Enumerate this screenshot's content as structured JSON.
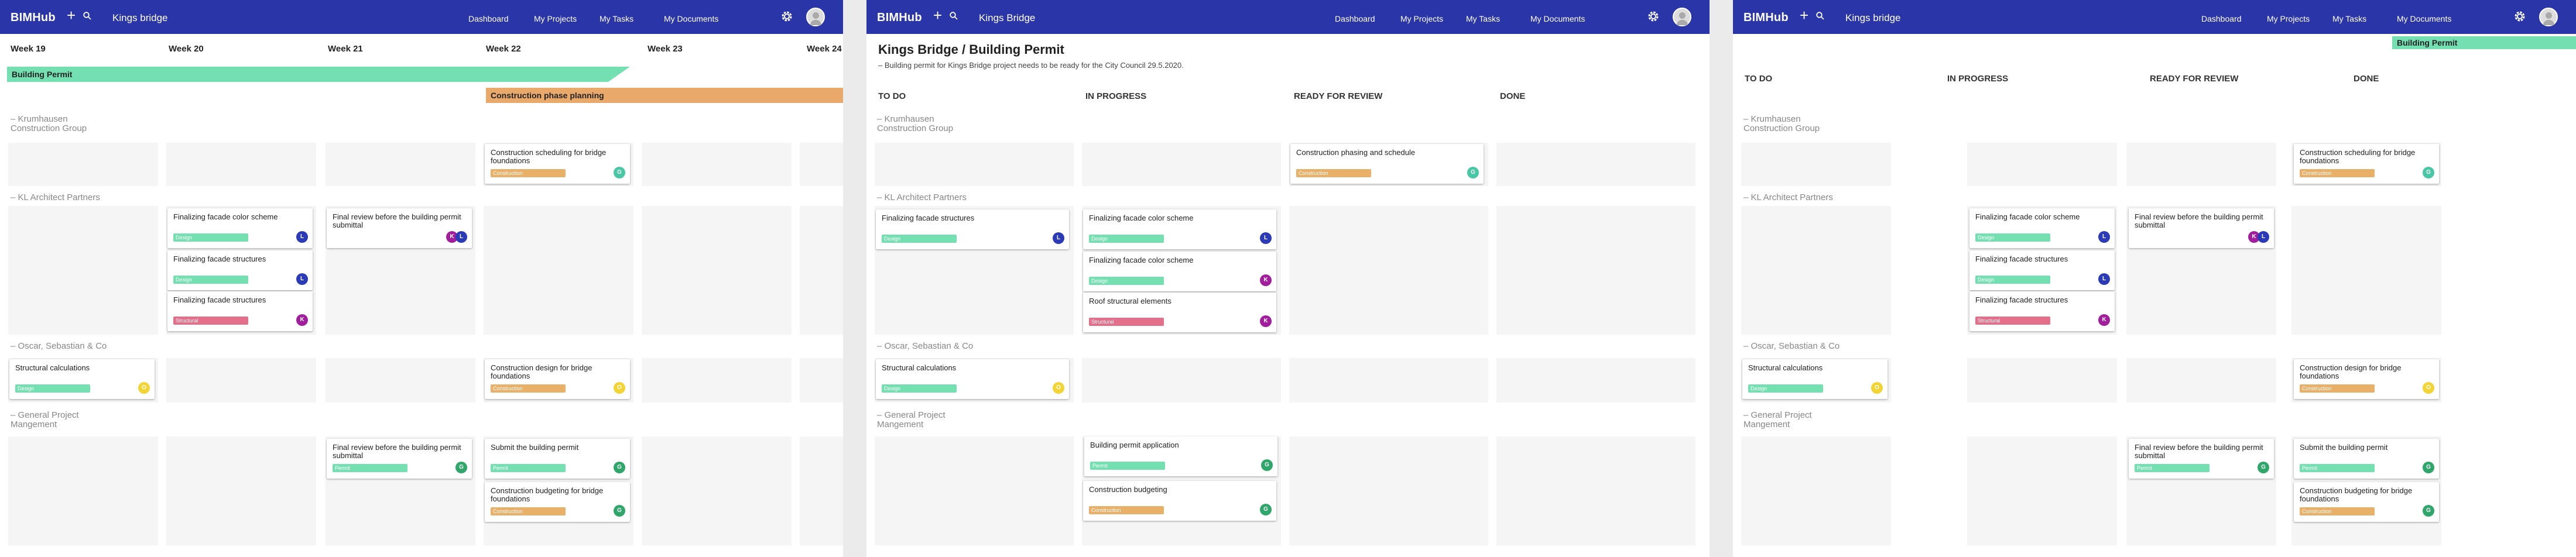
{
  "app": {
    "logo": "BIMHub",
    "nav": [
      "Dashboard",
      "My Projects",
      "My Tasks",
      "My Documents"
    ]
  },
  "panels": [
    {
      "project": "Kings bridge"
    },
    {
      "project": "Kings Bridge"
    },
    {
      "project": "Kings bridge"
    }
  ],
  "timeline": {
    "weeks": [
      "Week 19",
      "Week 20",
      "Week 21",
      "Week 22",
      "Week 23",
      "Week 24"
    ],
    "bars": [
      "Building Permit",
      "Construction phase  planning"
    ]
  },
  "board": {
    "title": "Kings Bridge / Building Permit",
    "description": "– Building permit for Kings Bridge project needs to be ready for the City Council 29.5.2020.",
    "columns": [
      "TO DO",
      "IN PROGRESS",
      "READY FOR REVIEW",
      "DONE"
    ]
  },
  "board3": {
    "columns": [
      "TO DO",
      "IN PROGRESS",
      "READY FOR REVIEW",
      "DONE"
    ],
    "badge": "Building Permit"
  },
  "groups": [
    "Krumhausen\nConstruction Group",
    "KL Architect Partners",
    "Oscar, Sebastian & Co",
    "General Project\nMangement"
  ],
  "cards": {
    "sched": "Construction scheduling for bridge foundations",
    "color": "Finalizing facade color scheme",
    "struct": "Finalizing facade structures",
    "review": "Final review before the building permit submittal",
    "calc": "Structural calculations",
    "design": "Construction design for bridge foundations",
    "submit": "Submit the building permit",
    "budget_bridge": "Construction budgeting for bridge foundations",
    "phasing": "Construction phasing and schedule",
    "roof": "Roof structural elements",
    "application": "Building permit application",
    "budgeting": "Construction budgeting"
  },
  "tags": {
    "construction": "Construction",
    "design": "Design",
    "structural": "Structural",
    "permit": "Permit"
  },
  "initials": {
    "L": "L",
    "K": "K",
    "S": "S",
    "O": "O",
    "G": "G",
    "M": "M"
  },
  "colors": {
    "header": "#2a35a8",
    "permit_bar": "#74e0b1",
    "planning_bar": "#e9a96b"
  }
}
